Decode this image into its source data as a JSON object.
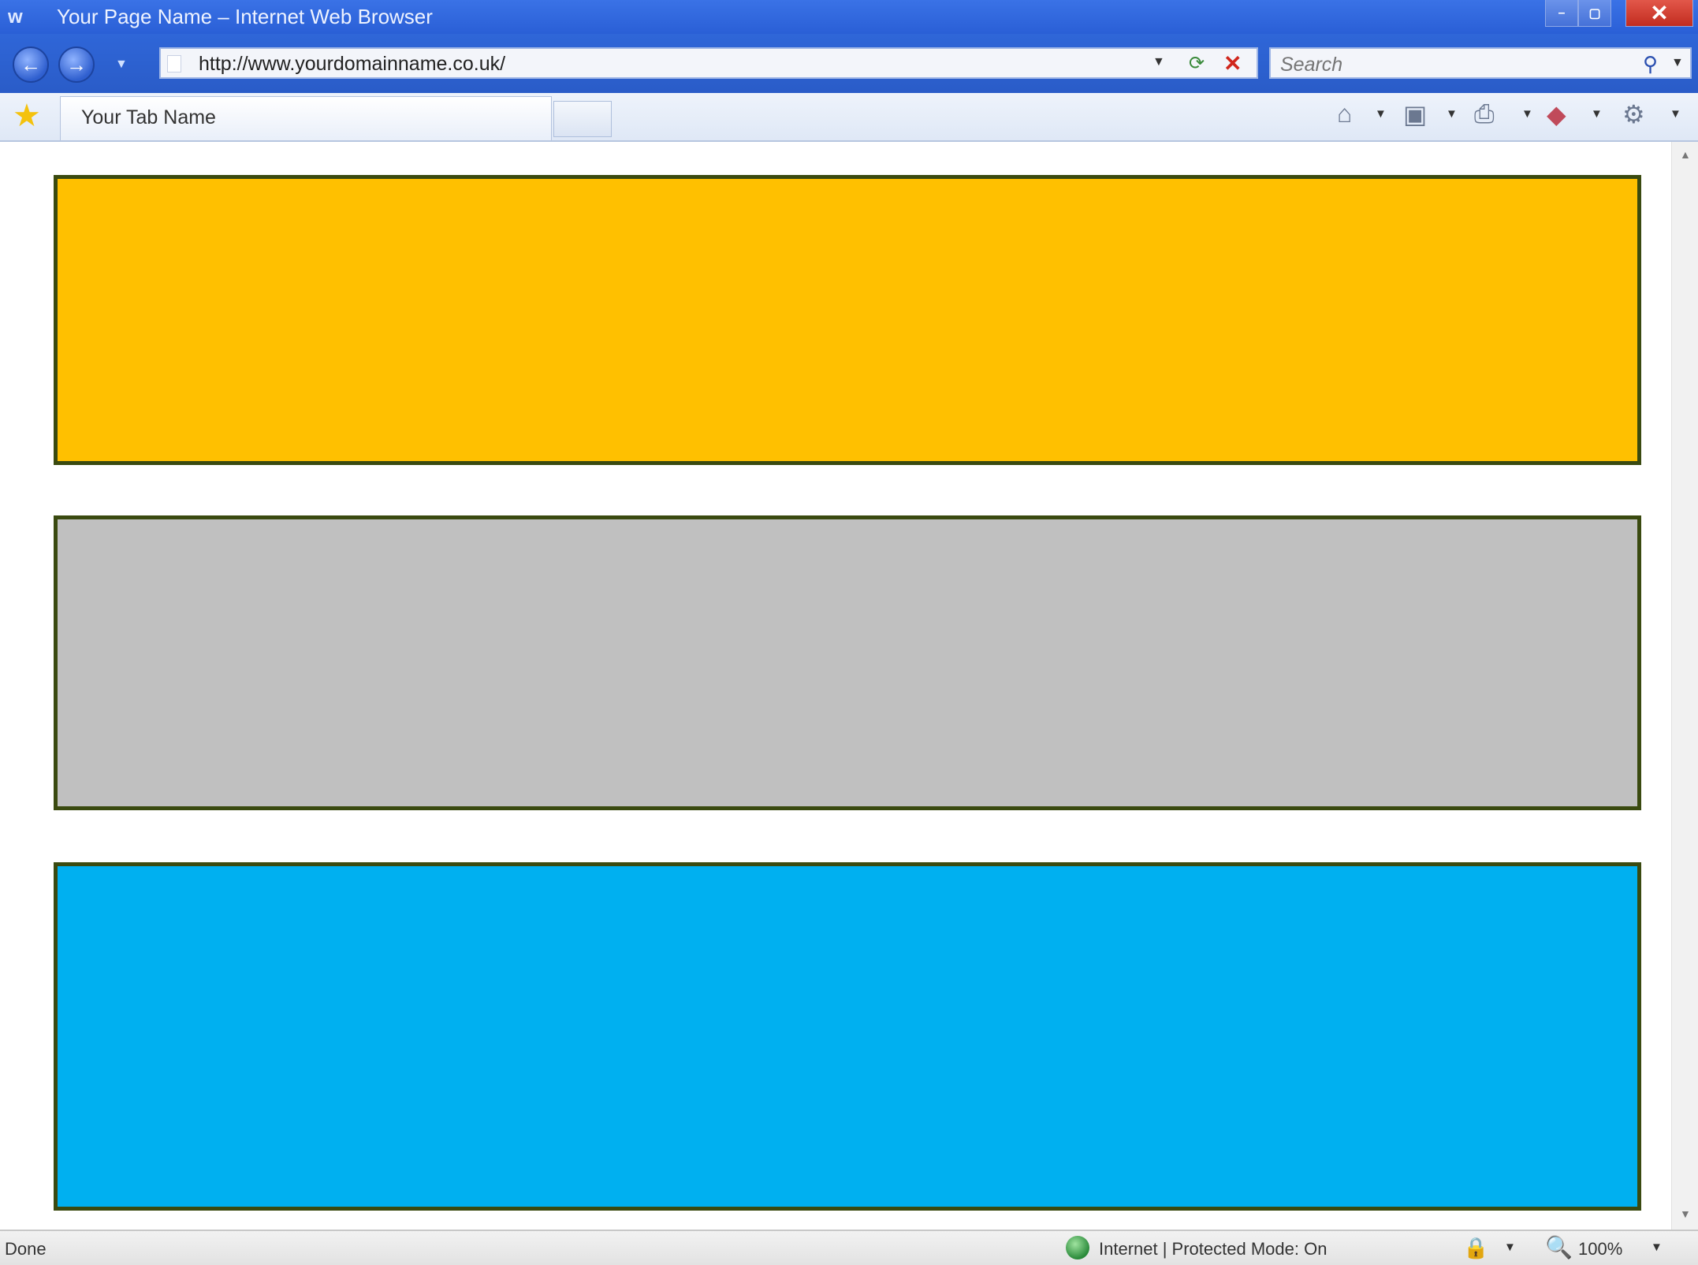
{
  "window": {
    "app_glyph": "w",
    "title": "Your Page Name – Internet Web Browser",
    "minimize_glyph": "–",
    "maximize_glyph": "▢",
    "close_glyph": "✕"
  },
  "navigation": {
    "back_glyph": "←",
    "forward_glyph": "→",
    "history_dropdown_glyph": "▼",
    "url": "http://www.yourdomainname.co.uk/",
    "url_dropdown_glyph": "▼",
    "refresh_glyph": "⟳",
    "stop_glyph": "✕",
    "search_placeholder": "Search",
    "search_glyph": "⚲",
    "search_dropdown_glyph": "▼"
  },
  "tabs": {
    "favorites_glyph": "★",
    "items": [
      {
        "label": "Your Tab Name"
      }
    ]
  },
  "toolbar": {
    "icons": [
      "home-icon",
      "feeds-icon",
      "print-icon",
      "page-icon",
      "tools-icon"
    ],
    "home_glyph": "⌂",
    "feeds_glyph": "▣",
    "print_glyph": "⎙",
    "page_glyph": "◆",
    "tools_glyph": "⚙",
    "dropdown_glyph": "▼"
  },
  "content": {
    "panels": [
      {
        "color": "#ffc000"
      },
      {
        "color": "#c0c0c0"
      },
      {
        "color": "#00b0f0"
      }
    ],
    "border_color": "#3a4a10"
  },
  "scrollbar": {
    "up_glyph": "▲",
    "down_glyph": "▼"
  },
  "status": {
    "text": "Done",
    "zone": "Internet | Protected Mode: On",
    "lock_glyph": "🔒",
    "dropdown_glyph": "▼",
    "zoom_glyph": "🔍",
    "zoom": "100%"
  }
}
